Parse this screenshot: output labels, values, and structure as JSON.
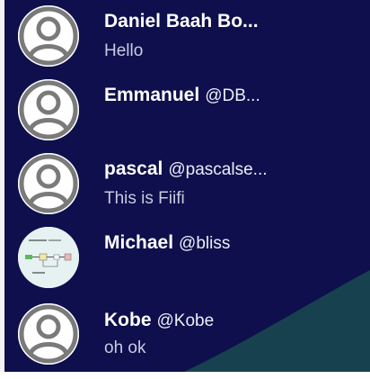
{
  "chats": [
    {
      "name": "Daniel Baah Bo...",
      "handle": "",
      "message": "Hello",
      "avatar": "default-avatar-icon"
    },
    {
      "name": "Emmanuel",
      "handle": "@DB...",
      "message": "",
      "avatar": "default-avatar-icon"
    },
    {
      "name": "pascal",
      "handle": "@pascalse...",
      "message": "This is Fiifi",
      "avatar": "default-avatar-icon"
    },
    {
      "name": "Michael",
      "handle": "@bliss",
      "message": "",
      "avatar": "diagram-thumbnail-avatar"
    },
    {
      "name": "Kobe",
      "handle": "@Kobe",
      "message": "oh ok",
      "avatar": "default-avatar-icon"
    }
  ],
  "colors": {
    "panel_bg": "#0e0f4c",
    "wave": "#17414f",
    "text": "#ffffff",
    "muted_text": "#c9cbe0"
  }
}
